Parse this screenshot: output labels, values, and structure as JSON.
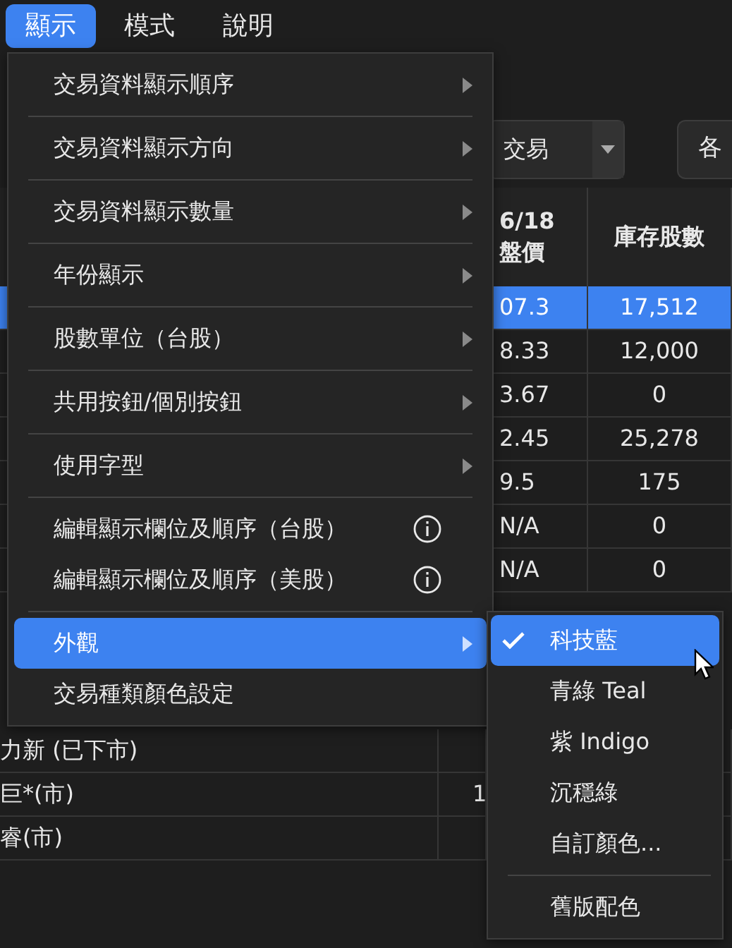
{
  "menubar": [
    {
      "label": "顯示",
      "selected": true
    },
    {
      "label": "模式",
      "selected": false
    },
    {
      "label": "說明",
      "selected": false
    }
  ],
  "toolbar": {
    "dropdown": "交易",
    "button": "各"
  },
  "table": {
    "columns": [
      {
        "lines": [
          "6/18",
          "盤價"
        ]
      },
      {
        "lines": [
          "庫存股數"
        ]
      }
    ],
    "rows": [
      {
        "cells": [
          "07.3",
          "17,512"
        ],
        "selected": true
      },
      {
        "cells": [
          "8.33",
          "12,000"
        ],
        "selected": false
      },
      {
        "cells": [
          "3.67",
          "0"
        ],
        "selected": false
      },
      {
        "cells": [
          "2.45",
          "25,278"
        ],
        "selected": false
      },
      {
        "cells": [
          "9.5",
          "175"
        ],
        "selected": false
      },
      {
        "cells": [
          "N/A",
          "0"
        ],
        "selected": false
      },
      {
        "cells": [
          "N/A",
          "0"
        ],
        "selected": false
      }
    ]
  },
  "lower_rows": [
    {
      "name": "力新 (已下市)"
    },
    {
      "name": "巨*(市)",
      "value": "1"
    },
    {
      "name": "睿(市)"
    }
  ],
  "menu": {
    "groups": [
      [
        {
          "label": "交易資料顯示順序",
          "kind": "submenu",
          "selected": false
        }
      ],
      [
        {
          "label": "交易資料顯示方向",
          "kind": "submenu",
          "selected": false
        }
      ],
      [
        {
          "label": "交易資料顯示數量",
          "kind": "submenu",
          "selected": false
        }
      ],
      [
        {
          "label": "年份顯示",
          "kind": "submenu",
          "selected": false
        }
      ],
      [
        {
          "label": "股數單位（台股）",
          "kind": "submenu",
          "selected": false
        }
      ],
      [
        {
          "label": "共用按鈕/個別按鈕",
          "kind": "submenu",
          "selected": false
        }
      ],
      [
        {
          "label": "使用字型",
          "kind": "submenu",
          "selected": false
        }
      ],
      [
        {
          "label": "編輯顯示欄位及順序（台股）",
          "kind": "info",
          "selected": false
        },
        {
          "label": "編輯顯示欄位及順序（美股）",
          "kind": "info",
          "selected": false
        }
      ],
      [
        {
          "label": "外觀",
          "kind": "submenu",
          "selected": true
        },
        {
          "label": "交易種類顏色設定",
          "kind": "plain",
          "selected": false
        }
      ]
    ]
  },
  "submenu": {
    "groups": [
      [
        {
          "label": "科技藍",
          "checked": true,
          "selected": true
        },
        {
          "label": "青綠 Teal",
          "checked": false,
          "selected": false
        },
        {
          "label": "紫 Indigo",
          "checked": false,
          "selected": false
        },
        {
          "label": "沉穩綠",
          "checked": false,
          "selected": false
        },
        {
          "label": "自訂顏色...",
          "checked": false,
          "selected": false
        }
      ],
      [
        {
          "label": "舊版配色",
          "checked": false,
          "selected": false
        }
      ]
    ]
  }
}
